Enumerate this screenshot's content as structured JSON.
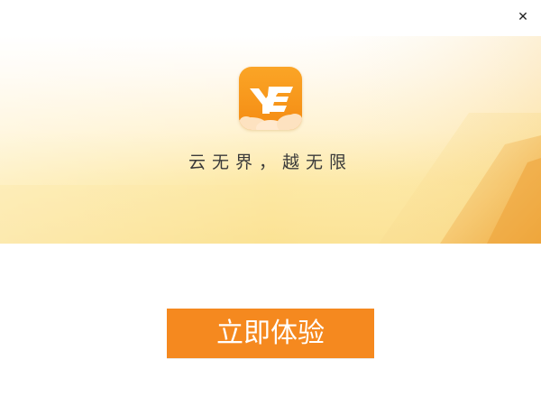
{
  "window": {
    "close_icon": "close-icon",
    "close_glyph": "✕"
  },
  "hero": {
    "logo_icon": "ye-logo-icon",
    "logo_text": "YE",
    "slogan": "云无界，越无限"
  },
  "cta": {
    "label": "立即体验"
  },
  "colors": {
    "accent": "#f5891f",
    "hero_yellow": "#fde9a6",
    "hero_orange": "#f2a83a",
    "logo_orange": "#f7941d",
    "text_dark": "#3a3a3a"
  }
}
